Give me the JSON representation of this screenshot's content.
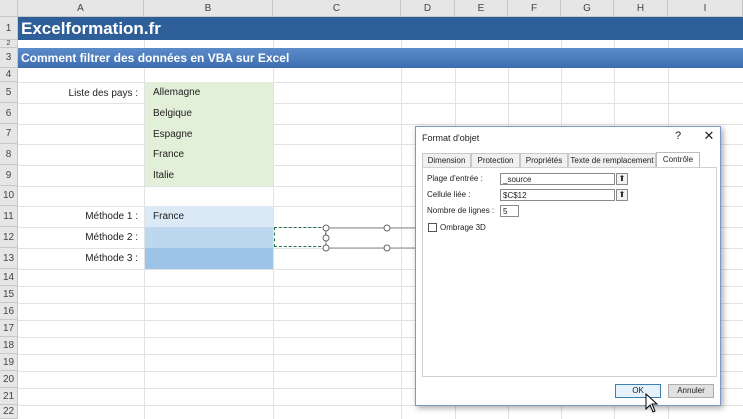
{
  "sheet": {
    "columns": [
      "A",
      "B",
      "C",
      "D",
      "E",
      "F",
      "G",
      "H",
      "I"
    ],
    "rows": [
      "1",
      "2",
      "3",
      "4",
      "5",
      "6",
      "7",
      "8",
      "9",
      "10",
      "11",
      "12",
      "13",
      "14",
      "15",
      "16",
      "17",
      "18",
      "19",
      "20"
    ]
  },
  "banner": {
    "title": "Excelformation.fr",
    "subtitle": "Comment filtrer des données en VBA sur Excel"
  },
  "countries": {
    "label": "Liste des pays :",
    "items": [
      "Allemagne",
      "Belgique",
      "Espagne",
      "France",
      "Italie"
    ]
  },
  "methods": {
    "m1_label": "Méthode 1 :",
    "m1_value": "France",
    "m2_label": "Méthode 2 :",
    "m3_label": "Méthode 3 :"
  },
  "dialog": {
    "title": "Format d'objet",
    "help": "?",
    "close": "✕",
    "tabs": [
      "Dimension",
      "Protection",
      "Propriétés",
      "Texte de remplacement",
      "Contrôle"
    ],
    "active_tab": "Contrôle",
    "input_range_label": "Plage d'entrée :",
    "input_range_value": "_source",
    "linked_cell_label": "Cellule liée :",
    "linked_cell_value": "$C$12",
    "line_count_label": "Nombre de lignes :",
    "line_count_value": "5",
    "shading_label": "Ombrage 3D",
    "ok": "OK",
    "cancel": "Annuler"
  },
  "colors": {
    "banner_dark": "#2f5f99",
    "banner_light": "#4a7bbd",
    "country_fill": "#e2efd9",
    "method1_fill": "#dce9f6",
    "method2_fill": "#bdd7ee",
    "method3_fill": "#9dc3e6"
  }
}
